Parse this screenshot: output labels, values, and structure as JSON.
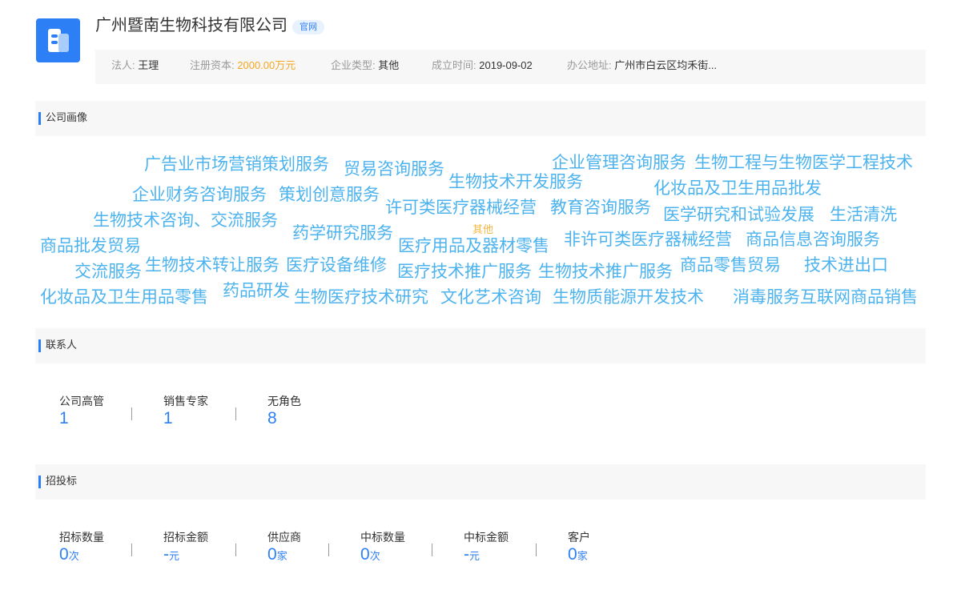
{
  "company": {
    "name": "广州暨南生物科技有限公司",
    "official_tag": "官网",
    "info": {
      "legal_label": "法人:",
      "legal_value": "王理",
      "capital_label": "注册资本:",
      "capital_value": "2000.00万元",
      "type_label": "企业类型:",
      "type_value": "其他",
      "founded_label": "成立时间:",
      "founded_value": "2019-09-02",
      "address_label": "办公地址:",
      "address_value": "广州市白云区均禾街..."
    }
  },
  "portrait": {
    "title": "公司画像",
    "words": [
      "广告业市场营销策划服务",
      "贸易咨询服务",
      "生物技术开发服务",
      "企业管理咨询服务",
      "生物工程与生物医学工程技术",
      "企业财务咨询服务",
      "策划创意服务",
      "许可类医疗器械经营",
      "教育咨询服务",
      "化妆品及卫生用品批发",
      "生物技术咨询、交流服务",
      "药学研究服务",
      "其他",
      "医学研究和试验发展",
      "生活清洗",
      "商品批发贸易",
      "医疗用品及器材零售",
      "非许可类医疗器械经营",
      "商品信息咨询服务",
      "交流服务",
      "生物技术转让服务",
      "医疗设备维修",
      "医疗技术推广服务",
      "生物技术推广服务",
      "商品零售贸易",
      "技术进出口",
      "化妆品及卫生用品零售",
      "药品研发",
      "生物医疗技术研究",
      "文化艺术咨询",
      "生物质能源开发技术",
      "消毒服务",
      "互联网商品销售"
    ]
  },
  "contacts": {
    "title": "联系人",
    "stats": [
      {
        "label": "公司高管",
        "value": "1"
      },
      {
        "label": "销售专家",
        "value": "1"
      },
      {
        "label": "无角色",
        "value": "8"
      }
    ]
  },
  "bidding": {
    "title": "招投标",
    "stats": [
      {
        "label": "招标数量",
        "value": "0",
        "unit": "次"
      },
      {
        "label": "招标金额",
        "value": "-",
        "unit": "元"
      },
      {
        "label": "供应商",
        "value": "0",
        "unit": "家"
      },
      {
        "label": "中标数量",
        "value": "0",
        "unit": "次"
      },
      {
        "label": "中标金额",
        "value": "-",
        "unit": "元"
      },
      {
        "label": "客户",
        "value": "0",
        "unit": "家"
      }
    ]
  }
}
